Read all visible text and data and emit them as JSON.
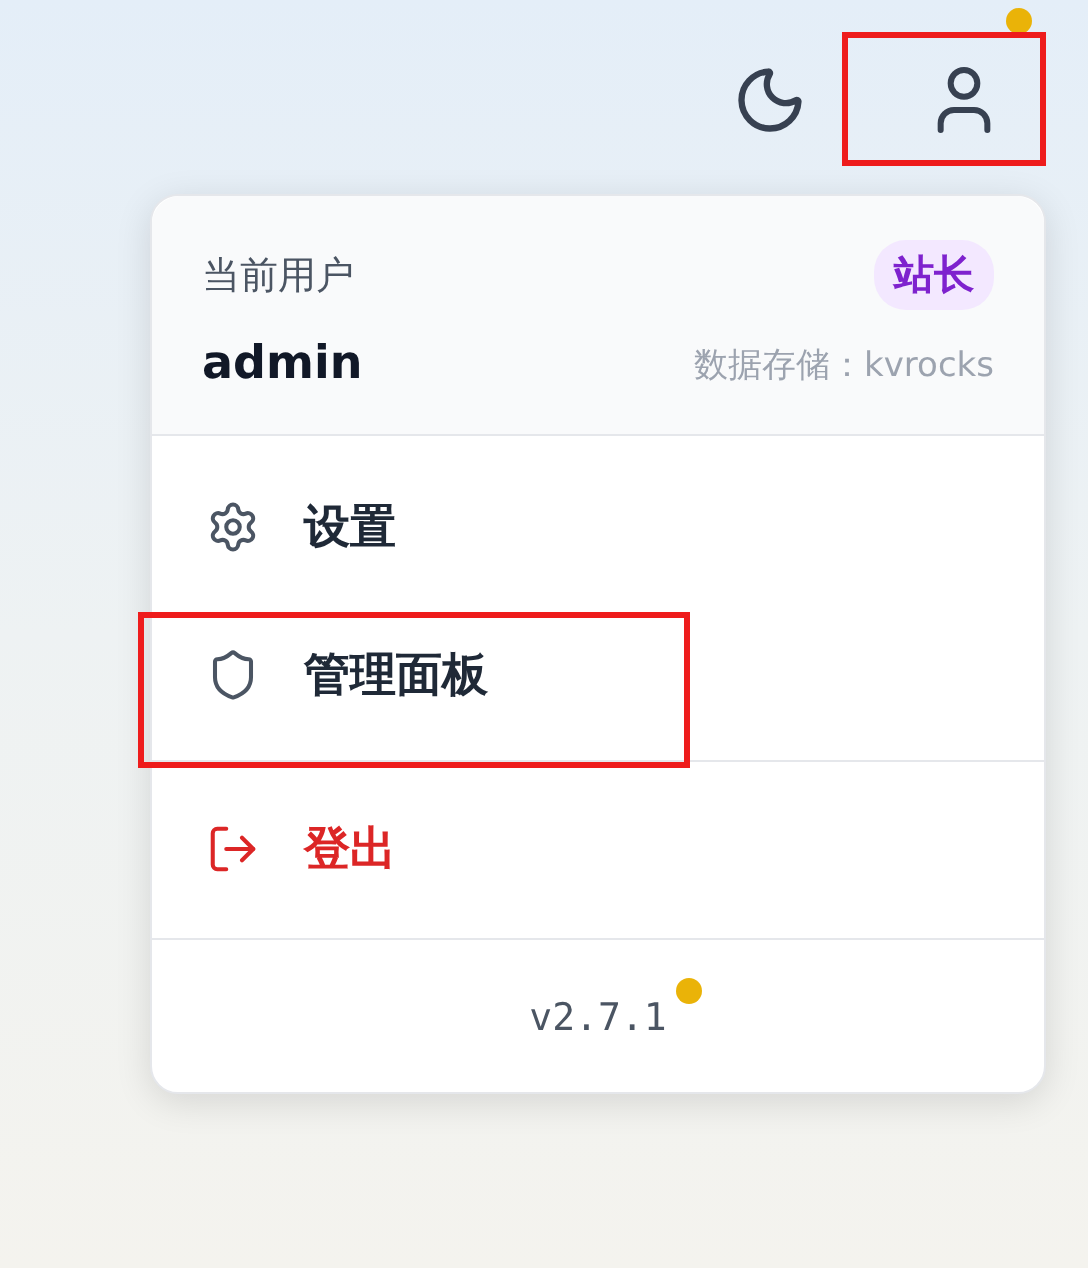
{
  "toolbar": {
    "user_button": {
      "highlighted": true,
      "notification": true
    }
  },
  "user_menu": {
    "header": {
      "label": "当前用户",
      "role_badge": "站长",
      "username": "admin",
      "storage": "数据存储：kvrocks"
    },
    "items": [
      {
        "kind": "settings",
        "label": "设置",
        "highlighted": false,
        "danger": false
      },
      {
        "kind": "admin",
        "label": "管理面板",
        "highlighted": true,
        "danger": false
      },
      {
        "kind": "logout",
        "label": "登出",
        "highlighted": false,
        "danger": true
      }
    ],
    "version": {
      "text": "v2.7.1",
      "notification": true
    }
  }
}
